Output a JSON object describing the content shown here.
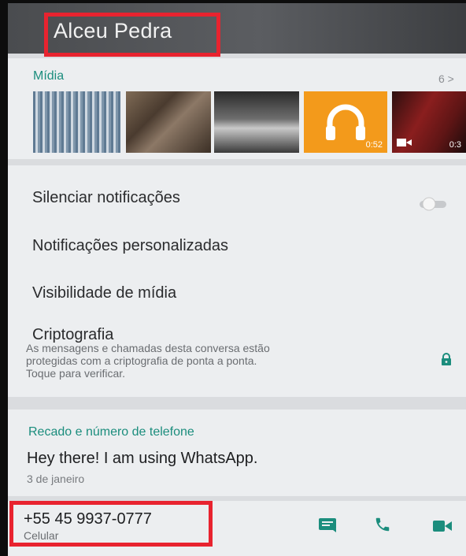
{
  "header": {
    "contact_name": "Alceu Pedra"
  },
  "media": {
    "title": "Mídia",
    "count": "6 >",
    "thumbnails": [
      {
        "kind": "image"
      },
      {
        "kind": "image"
      },
      {
        "kind": "image"
      },
      {
        "kind": "audio",
        "icon": "headphones-icon",
        "duration": "0:52"
      },
      {
        "kind": "video",
        "icon": "video-camera-icon",
        "duration": "0:3"
      }
    ]
  },
  "settings": {
    "mute": {
      "label": "Silenciar notificações",
      "state": "off"
    },
    "custom_notifications": {
      "label": "Notificações personalizadas"
    },
    "media_visibility": {
      "label": "Visibilidade de mídia"
    },
    "encryption": {
      "title": "Criptografia",
      "desc_line1": "As mensagens e chamadas desta conversa estão",
      "desc_line2": "protegidas com a criptografia de ponta a ponta.",
      "desc_line3": "Toque para verificar.",
      "icon": "lock-icon"
    }
  },
  "about": {
    "title": "Recado e número de telefone",
    "status": "Hey there! I am using WhatsApp.",
    "date": "3 de janeiro"
  },
  "phone": {
    "number": "+55 45 9937-0777",
    "type": "Celular",
    "actions": [
      "message-icon",
      "call-icon",
      "video-call-icon"
    ]
  },
  "colors": {
    "accent": "#1b8d7d",
    "highlight_box": "#e8232f",
    "audio_tile": "#f39a1b"
  }
}
